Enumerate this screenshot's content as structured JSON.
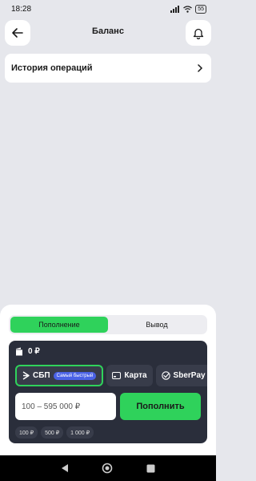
{
  "status_bar": {
    "time": "18:28",
    "battery": "55"
  },
  "header": {
    "title": "Баланс"
  },
  "history": {
    "label": "История операций"
  },
  "sheet": {
    "tabs": [
      {
        "label": "Пополнение"
      },
      {
        "label": "Вывод"
      }
    ],
    "balance": "0 ₽",
    "methods": [
      {
        "label": "СБП",
        "badge": "Самый быстрый"
      },
      {
        "label": "Карта"
      },
      {
        "label": "SberPay"
      }
    ],
    "amount_placeholder": "100 – 595 000 ₽",
    "topup_label": "Пополнить",
    "chips": [
      "100 ₽",
      "500 ₽",
      "1 000 ₽"
    ]
  },
  "colors": {
    "accent": "#2fd25b",
    "panel": "#2a2e3b",
    "badge": "#4a62e6",
    "background": "#e6e7ec"
  },
  "icons": [
    "arrow-left-icon",
    "bell-icon",
    "chevron-right-icon",
    "wallet-icon",
    "sbp-icon",
    "card-icon",
    "sberpay-icon"
  ]
}
